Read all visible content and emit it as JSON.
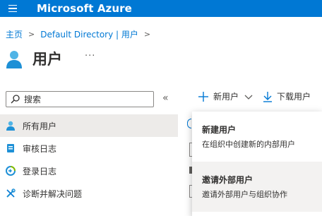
{
  "header": {
    "brand": "Microsoft Azure"
  },
  "breadcrumb": {
    "items": [
      "主页",
      "Default Directory | 用户"
    ]
  },
  "page": {
    "title": "用户",
    "more": "···"
  },
  "search": {
    "placeholder": "搜索"
  },
  "toolbar": {
    "new_user": "新用户",
    "download_users": "下载用户"
  },
  "sidebar": {
    "items": [
      {
        "label": "所有用户",
        "active": true
      },
      {
        "label": "审核日志"
      },
      {
        "label": "登录日志"
      },
      {
        "label": "诊断并解决问题"
      }
    ]
  },
  "dropdown": {
    "items": [
      {
        "title": "新建用户",
        "desc": "在组织中创建新的内部用户"
      },
      {
        "title": "邀请外部用户",
        "desc": "邀请外部用户与组织协作"
      }
    ]
  },
  "colors": {
    "brand": "#0078d4",
    "active_bg": "#edebe9",
    "hover_bg": "#f3f2f1"
  }
}
